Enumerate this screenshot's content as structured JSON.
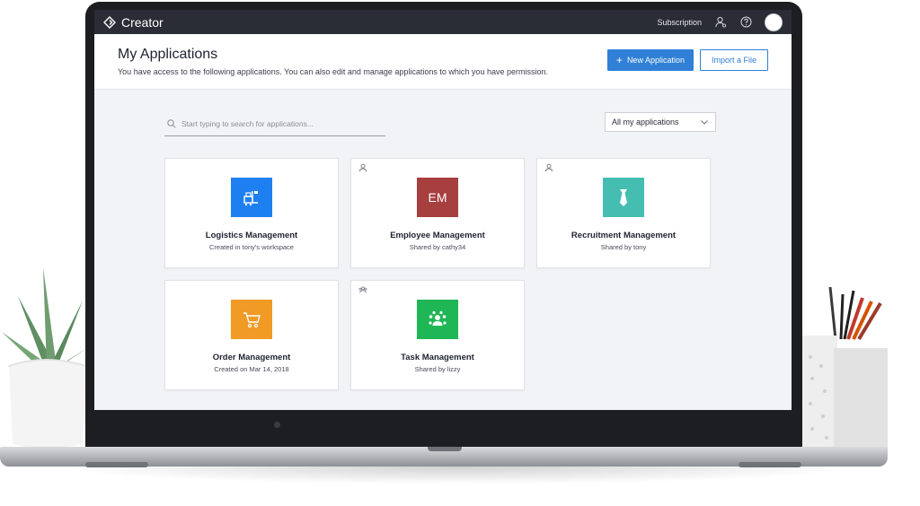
{
  "app": {
    "brand": "Creator",
    "subscription_label": "Subscription"
  },
  "header": {
    "title": "My Applications",
    "subtitle": "You have access to the following applications. You can also edit and manage applications to which you have permission.",
    "new_application_label": "New Application",
    "import_label": "Import a File"
  },
  "toolbar": {
    "search_placeholder": "Start typing to search for applications...",
    "filter_value": "All my applications"
  },
  "colors": {
    "accent": "#2f80d6",
    "topbar": "#2a2c36"
  },
  "applications": [
    {
      "name": "Logistics Management",
      "subtitle": "Created in tony's workspace",
      "icon": "forklift-icon",
      "color": "#1e7ff0",
      "badge": "",
      "shared": false
    },
    {
      "name": "Employee Management",
      "subtitle": "Shared by cathy34",
      "icon": "initials-icon",
      "color": "#a83f3f",
      "badge": "EM",
      "shared": true
    },
    {
      "name": "Recruitment Management",
      "subtitle": "Shared by tony",
      "icon": "necktie-icon",
      "color": "#45bdb0",
      "badge": "",
      "shared": true
    },
    {
      "name": "Order Management",
      "subtitle": "Created on Mar 14, 2018",
      "icon": "cart-icon",
      "color": "#f19a26",
      "badge": "",
      "shared": false
    },
    {
      "name": "Task Management",
      "subtitle": "Shared by lizzy",
      "icon": "team-icon",
      "color": "#1fb655",
      "badge": "",
      "shared": true
    }
  ]
}
